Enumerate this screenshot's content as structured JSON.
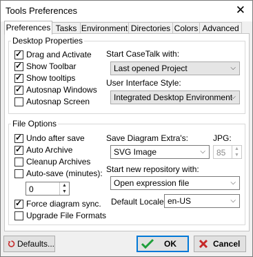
{
  "window": {
    "title": "Tools Preferences",
    "close_glyph": "✕"
  },
  "tabs": [
    {
      "label": "Preferences",
      "active": true
    },
    {
      "label": "Tasks"
    },
    {
      "label": "Environment"
    },
    {
      "label": "Directories"
    },
    {
      "label": "Colors"
    },
    {
      "label": "Advanced"
    }
  ],
  "desktop": {
    "group_label": "Desktop Properties",
    "checkboxes": [
      {
        "label": "Drag and Activate",
        "checked": true
      },
      {
        "label": "Show Toolbar",
        "checked": true
      },
      {
        "label": "Show tooltips",
        "checked": true
      },
      {
        "label": "Autosnap Windows",
        "checked": true
      },
      {
        "label": "Autosnap Screen",
        "checked": false
      }
    ],
    "start_label": "Start CaseTalk with:",
    "start_value": "Last opened Project",
    "style_label": "User Interface Style:",
    "style_value": "Integrated Desktop Environment"
  },
  "file": {
    "group_label": "File Options",
    "checkboxes": [
      {
        "label": "Undo after save",
        "checked": true
      },
      {
        "label": "Auto Archive",
        "checked": true
      },
      {
        "label": "Cleanup Archives",
        "checked": false
      },
      {
        "label": "Auto-save (minutes):",
        "checked": false
      },
      {
        "label": "Force diagram sync.",
        "checked": true
      },
      {
        "label": "Upgrade File Formats",
        "checked": false
      }
    ],
    "autosave_value": "0",
    "extras_label": "Save Diagram Extra's:",
    "extras_value": "SVG Image",
    "jpg_label": "JPG:",
    "jpg_value": "85",
    "repo_label": "Start new repository with:",
    "repo_value": "Open expression file",
    "locale_label": "Default Locale:",
    "locale_value": "en-US"
  },
  "buttons": {
    "defaults": "Defaults...",
    "ok": "OK",
    "cancel": "Cancel"
  },
  "colors": {
    "ok_check": "#1e9e3a",
    "cancel_x": "#c62828",
    "defaults_icon": "#c62828"
  }
}
